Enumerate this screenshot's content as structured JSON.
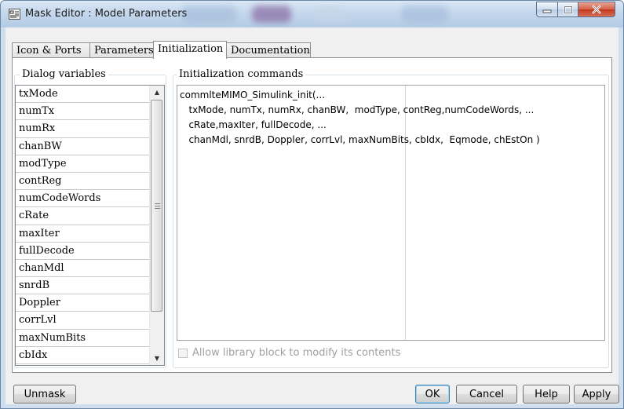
{
  "window": {
    "title": "Mask Editor : Model Parameters"
  },
  "tabs": [
    {
      "label": "Icon & Ports"
    },
    {
      "label": "Parameters"
    },
    {
      "label": "Initialization"
    },
    {
      "label": "Documentation"
    }
  ],
  "active_tab": "Initialization",
  "dialog_variables": {
    "label": "Dialog variables",
    "items": [
      "txMode",
      "numTx",
      "numRx",
      "chanBW",
      "modType",
      "contReg",
      "numCodeWords",
      "cRate",
      "maxIter",
      "fullDecode",
      "chanMdl",
      "snrdB",
      "Doppler",
      "corrLvl",
      "maxNumBits",
      "cbIdx"
    ]
  },
  "init_commands": {
    "label": "Initialization commands",
    "lines": [
      "commlteMIMO_Simulink_init(...",
      "   txMode, numTx, numRx, chanBW,  modType, contReg,numCodeWords, ...",
      "   cRate,maxIter, fullDecode, ...",
      "   chanMdl, snrdB, Doppler, corrLvl, maxNumBits, cbIdx,  Eqmode, chEstOn )"
    ]
  },
  "allow_modify": {
    "label": "Allow library block to modify its contents",
    "checked": false,
    "enabled": false
  },
  "buttons": {
    "unmask": "Unmask",
    "ok": "OK",
    "cancel": "Cancel",
    "help": "Help",
    "apply": "Apply"
  }
}
